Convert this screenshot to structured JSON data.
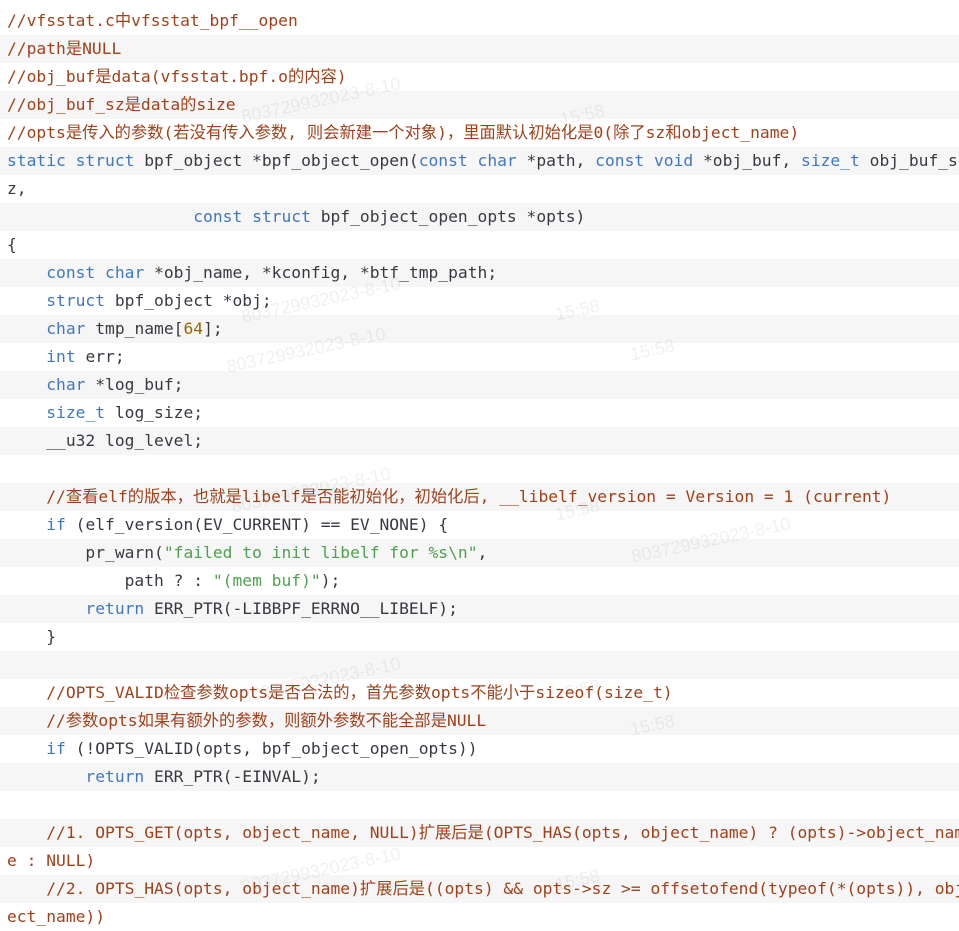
{
  "code_lines": [
    [
      {
        "c": "cmt",
        "t": "//vfsstat.c中vfsstat_bpf__open"
      }
    ],
    [
      {
        "c": "cmt",
        "t": "//path是NULL"
      }
    ],
    [
      {
        "c": "cmt",
        "t": "//obj_buf是data(vfsstat.bpf.o的内容)"
      }
    ],
    [
      {
        "c": "cmt",
        "t": "//obj_buf_sz是data的size"
      }
    ],
    [
      {
        "c": "cmt",
        "t": "//opts是传入的参数(若没有传入参数, 则会新建一个对象)，里面默认初始化是0(除了sz和object_name)"
      }
    ],
    [
      {
        "c": "kw",
        "t": "static struct "
      },
      {
        "c": "pl",
        "t": "bpf_object *bpf_object_open("
      },
      {
        "c": "kw",
        "t": "const char "
      },
      {
        "c": "pl",
        "t": "*path, "
      },
      {
        "c": "kw",
        "t": "const void "
      },
      {
        "c": "pl",
        "t": "*obj_buf, "
      },
      {
        "c": "kw",
        "t": "size_t "
      },
      {
        "c": "pl",
        "t": "obj_buf_s"
      }
    ],
    [
      {
        "c": "pl",
        "t": "z,"
      }
    ],
    [
      {
        "c": "pl",
        "t": "                   "
      },
      {
        "c": "kw",
        "t": "const struct "
      },
      {
        "c": "pl",
        "t": "bpf_object_open_opts *opts)"
      }
    ],
    [
      {
        "c": "pl",
        "t": "{"
      }
    ],
    [
      {
        "c": "pl",
        "t": "    "
      },
      {
        "c": "kw",
        "t": "const char "
      },
      {
        "c": "pl",
        "t": "*obj_name, *kconfig, *btf_tmp_path;"
      }
    ],
    [
      {
        "c": "pl",
        "t": "    "
      },
      {
        "c": "kw",
        "t": "struct "
      },
      {
        "c": "pl",
        "t": "bpf_object *obj;"
      }
    ],
    [
      {
        "c": "pl",
        "t": "    "
      },
      {
        "c": "kw",
        "t": "char "
      },
      {
        "c": "pl",
        "t": "tmp_name["
      },
      {
        "c": "num",
        "t": "64"
      },
      {
        "c": "pl",
        "t": "];"
      }
    ],
    [
      {
        "c": "pl",
        "t": "    "
      },
      {
        "c": "kw",
        "t": "int "
      },
      {
        "c": "pl",
        "t": "err;"
      }
    ],
    [
      {
        "c": "pl",
        "t": "    "
      },
      {
        "c": "kw",
        "t": "char "
      },
      {
        "c": "pl",
        "t": "*log_buf;"
      }
    ],
    [
      {
        "c": "pl",
        "t": "    "
      },
      {
        "c": "kw",
        "t": "size_t "
      },
      {
        "c": "pl",
        "t": "log_size;"
      }
    ],
    [
      {
        "c": "pl",
        "t": "    __u32 log_level;"
      }
    ],
    [],
    [
      {
        "c": "pl",
        "t": "    "
      },
      {
        "c": "cmt",
        "t": "//查看elf的版本，也就是libelf是否能初始化，初始化后, __libelf_version = Version = 1 (current)"
      }
    ],
    [
      {
        "c": "pl",
        "t": "    "
      },
      {
        "c": "kw",
        "t": "if "
      },
      {
        "c": "pl",
        "t": "(elf_version(EV_CURRENT) == EV_NONE) {"
      }
    ],
    [
      {
        "c": "pl",
        "t": "        pr_warn("
      },
      {
        "c": "str",
        "t": "\"failed to init libelf for %s\\n\""
      },
      {
        "c": "pl",
        "t": ","
      }
    ],
    [
      {
        "c": "pl",
        "t": "            path ? : "
      },
      {
        "c": "str",
        "t": "\"(mem buf)\""
      },
      {
        "c": "pl",
        "t": ");"
      }
    ],
    [
      {
        "c": "pl",
        "t": "        "
      },
      {
        "c": "kw",
        "t": "return "
      },
      {
        "c": "pl",
        "t": "ERR_PTR(-LIBBPF_ERRNO__LIBELF);"
      }
    ],
    [
      {
        "c": "pl",
        "t": "    }"
      }
    ],
    [],
    [
      {
        "c": "pl",
        "t": "    "
      },
      {
        "c": "cmt",
        "t": "//OPTS_VALID检查参数opts是否合法的，首先参数opts不能小于sizeof(size_t)"
      }
    ],
    [
      {
        "c": "pl",
        "t": "    "
      },
      {
        "c": "cmt",
        "t": "//参数opts如果有额外的参数，则额外参数不能全部是NULL"
      }
    ],
    [
      {
        "c": "pl",
        "t": "    "
      },
      {
        "c": "kw",
        "t": "if "
      },
      {
        "c": "pl",
        "t": "(!OPTS_VALID(opts, bpf_object_open_opts))"
      }
    ],
    [
      {
        "c": "pl",
        "t": "        "
      },
      {
        "c": "kw",
        "t": "return "
      },
      {
        "c": "pl",
        "t": "ERR_PTR(-EINVAL);"
      }
    ],
    [],
    [
      {
        "c": "pl",
        "t": "    "
      },
      {
        "c": "cmt",
        "t": "//1. OPTS_GET(opts, object_name, NULL)扩展后是(OPTS_HAS(opts, object_name) ? (opts)->object_nam"
      }
    ],
    [
      {
        "c": "cmt",
        "t": "e : NULL)"
      }
    ],
    [
      {
        "c": "pl",
        "t": "    "
      },
      {
        "c": "cmt",
        "t": "//2. OPTS_HAS(opts, object_name)扩展后是((opts) && opts->sz >= offsetofend(typeof(*(opts)), obj"
      }
    ],
    [
      {
        "c": "cmt",
        "t": "ect_name))"
      }
    ]
  ],
  "watermarks": [
    {
      "text": "803729932023-8-10"
    },
    {
      "text": "15:58"
    },
    {
      "text": "803729932023-8-10"
    },
    {
      "text": "15:58"
    },
    {
      "text": "803729932023-8-10"
    },
    {
      "text": "15:58"
    },
    {
      "text": "803729932023-8-10"
    },
    {
      "text": "15:58"
    },
    {
      "text": "803729932023-8-10"
    },
    {
      "text": "15:58"
    },
    {
      "text": "803729932023-8-10"
    },
    {
      "text": "15:58"
    },
    {
      "text": "803729932023-8-10"
    },
    {
      "text": "15:58"
    }
  ]
}
